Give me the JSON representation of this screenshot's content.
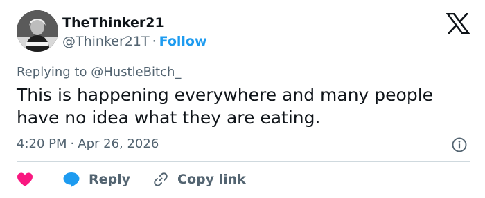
{
  "author": {
    "name": "TheThinker21",
    "handle": "@Thinker21T",
    "separator": "·",
    "follow_label": "Follow"
  },
  "reply_context": {
    "prefix": "Replying to",
    "mention": "@HustleBitch_"
  },
  "tweet": {
    "text": "This is happening everywhere and many people have no idea what they are eating."
  },
  "meta": {
    "time": "4:20 PM",
    "separator": "·",
    "date": "Apr 26, 2026"
  },
  "actions": {
    "reply_label": "Reply",
    "copy_link_label": "Copy link"
  },
  "colors": {
    "accent": "#1d9bf0",
    "like": "#f91880",
    "text": "#0f1419",
    "muted": "#536471",
    "divider": "#cfd9de"
  },
  "icons": [
    "avatar",
    "x-logo-icon",
    "info-icon",
    "heart-icon",
    "reply-bubble-icon",
    "link-icon"
  ]
}
